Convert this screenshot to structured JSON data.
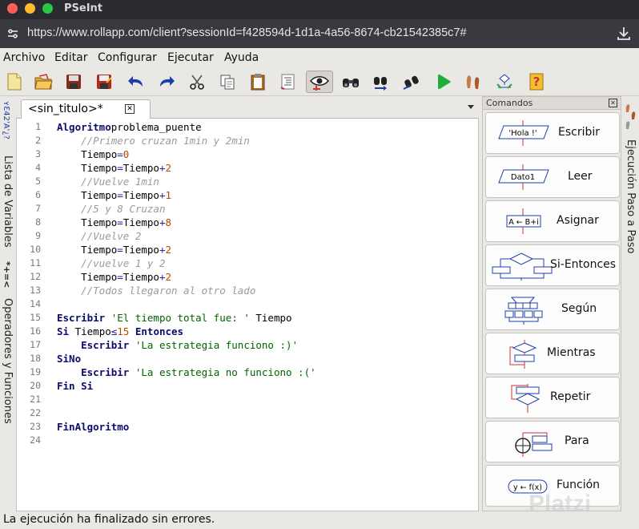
{
  "window": {
    "title": "PSeInt"
  },
  "browser": {
    "url": "https://www.rollapp.com/client?sessionId=f428594d-1d1a-4a56-8674-cb21542385c7#"
  },
  "menu": [
    "Archivo",
    "Editar",
    "Configurar",
    "Ejecutar",
    "Ayuda"
  ],
  "toolbar": {
    "icons": [
      "new-file",
      "open-file",
      "save",
      "save-as",
      "undo",
      "redo",
      "cut",
      "copy",
      "paste",
      "indent",
      "step-by-step-eye",
      "find",
      "find-replace",
      "edit-tools",
      "run",
      "step",
      "flowchart",
      "help"
    ]
  },
  "left_tabs": {
    "variables": "Lista de Variables",
    "operators": "Operadores y Funciones",
    "variables_glyph": "ʏƐ42'A'¿?",
    "operators_glyph": "*+=<"
  },
  "editor": {
    "tab_label": "<sin_titulo>*",
    "lines": [
      {
        "n": "1",
        "segs": [
          [
            "kw",
            "Algoritmo"
          ],
          [
            "",
            "problema_puente"
          ]
        ]
      },
      {
        "n": "2",
        "segs": [
          [
            "",
            "    "
          ],
          [
            "cm",
            "//Primero cruzan 1min y 2min"
          ]
        ]
      },
      {
        "n": "3",
        "segs": [
          [
            "",
            "    Tiempo"
          ],
          [
            "op",
            "="
          ],
          [
            "num",
            "0"
          ]
        ]
      },
      {
        "n": "4",
        "segs": [
          [
            "",
            "    Tiempo"
          ],
          [
            "op",
            "="
          ],
          [
            "",
            "Tiempo"
          ],
          [
            "op",
            "+"
          ],
          [
            "num",
            "2"
          ]
        ]
      },
      {
        "n": "5",
        "segs": [
          [
            "",
            "    "
          ],
          [
            "cm",
            "//Vuelve 1min"
          ]
        ]
      },
      {
        "n": "6",
        "segs": [
          [
            "",
            "    Tiempo"
          ],
          [
            "op",
            "="
          ],
          [
            "",
            "Tiempo"
          ],
          [
            "op",
            "+"
          ],
          [
            "num",
            "1"
          ]
        ]
      },
      {
        "n": "7",
        "segs": [
          [
            "",
            "    "
          ],
          [
            "cm",
            "//5 y 8 Cruzan"
          ]
        ]
      },
      {
        "n": "8",
        "segs": [
          [
            "",
            "    Tiempo"
          ],
          [
            "op",
            "="
          ],
          [
            "",
            "Tiempo"
          ],
          [
            "op",
            "+"
          ],
          [
            "num",
            "8"
          ]
        ]
      },
      {
        "n": "9",
        "segs": [
          [
            "",
            "    "
          ],
          [
            "cm",
            "//Vuelve 2"
          ]
        ]
      },
      {
        "n": "10",
        "segs": [
          [
            "",
            "    Tiempo"
          ],
          [
            "op",
            "="
          ],
          [
            "",
            "Tiempo"
          ],
          [
            "op",
            "+"
          ],
          [
            "num",
            "2"
          ]
        ]
      },
      {
        "n": "11",
        "segs": [
          [
            "",
            "    "
          ],
          [
            "cm",
            "//vuelve 1 y 2"
          ]
        ]
      },
      {
        "n": "12",
        "segs": [
          [
            "",
            "    Tiempo"
          ],
          [
            "op",
            "="
          ],
          [
            "",
            "Tiempo"
          ],
          [
            "op",
            "+"
          ],
          [
            "num",
            "2"
          ]
        ]
      },
      {
        "n": "13",
        "segs": [
          [
            "",
            "    "
          ],
          [
            "cm",
            "//Todos llegaron al otro lado"
          ]
        ]
      },
      {
        "n": "14",
        "segs": []
      },
      {
        "n": "15",
        "segs": [
          [
            "kw",
            "Escribir"
          ],
          [
            "",
            ""
          ],
          [
            "str",
            "'El tiempo total fue: '"
          ],
          [
            "",
            " Tiempo"
          ]
        ]
      },
      {
        "n": "16",
        "segs": [
          [
            "kw",
            "Si"
          ],
          [
            "",
            " Tiempo"
          ],
          [
            "op",
            "≤"
          ],
          [
            "num",
            "15"
          ],
          [
            "",
            ""
          ],
          [
            "kw",
            "Entonces"
          ]
        ]
      },
      {
        "n": "17",
        "segs": [
          [
            "",
            "    "
          ],
          [
            "kw",
            "Escribir"
          ],
          [
            "",
            ""
          ],
          [
            "str",
            "'La estrategia funciono :)'"
          ]
        ]
      },
      {
        "n": "18",
        "segs": [
          [
            "kw",
            "SiNo"
          ]
        ]
      },
      {
        "n": "19",
        "segs": [
          [
            "",
            "    "
          ],
          [
            "kw",
            "Escribir"
          ],
          [
            "",
            ""
          ],
          [
            "str",
            "'La estrategia no funciono :('"
          ]
        ]
      },
      {
        "n": "20",
        "segs": [
          [
            "kw",
            "Fin Si"
          ]
        ]
      },
      {
        "n": "21",
        "segs": []
      },
      {
        "n": "22",
        "segs": []
      },
      {
        "n": "23",
        "segs": [
          [
            "kw",
            "FinAlgoritmo"
          ]
        ]
      },
      {
        "n": "24",
        "segs": []
      }
    ]
  },
  "commands": {
    "title": "Comandos",
    "buttons": [
      {
        "label": "Escribir",
        "icon": "write-icon",
        "icon_text": "'Hola !'"
      },
      {
        "label": "Leer",
        "icon": "read-icon",
        "icon_text": "Dato1"
      },
      {
        "label": "Asignar",
        "icon": "assign-icon",
        "icon_text": "A ← B+i"
      },
      {
        "label": "Si-Entonces",
        "icon": "if-then-icon",
        "icon_text": ""
      },
      {
        "label": "Según",
        "icon": "switch-icon",
        "icon_text": ""
      },
      {
        "label": "Mientras",
        "icon": "while-icon",
        "icon_text": ""
      },
      {
        "label": "Repetir",
        "icon": "repeat-icon",
        "icon_text": ""
      },
      {
        "label": "Para",
        "icon": "for-icon",
        "icon_text": ""
      },
      {
        "label": "Función",
        "icon": "function-icon",
        "icon_text": "y ← f(x)"
      }
    ]
  },
  "right_tab": {
    "label": "Ejecución Paso a Paso"
  },
  "status": {
    "text": "La ejecución ha finalizado sin errores."
  },
  "watermark": "Platzi",
  "colors": {
    "keyword": "#0b0b6e",
    "comment": "#9a9a9a",
    "string": "#006400",
    "number": "#b84a00",
    "close_button": "#ff5f57",
    "minimize_button": "#febc2e",
    "zoom_button": "#28c840"
  }
}
